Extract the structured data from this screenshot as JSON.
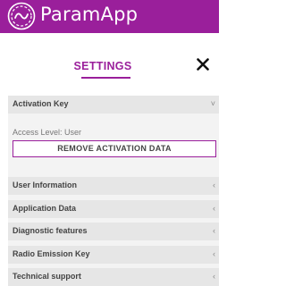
{
  "app_bar": {
    "title": "ParamApp",
    "logo_icon": "wave-gear-logo",
    "background": "#9a1f9b"
  },
  "header": {
    "title": "SETTINGS",
    "close_icon": "close-icon",
    "accent": "#9a1f9b"
  },
  "sections": [
    {
      "label": "Activation Key",
      "expanded": true,
      "chevron": "˅"
    },
    {
      "label": "User Information",
      "expanded": false,
      "chevron": "‹"
    },
    {
      "label": "Application Data",
      "expanded": false,
      "chevron": "‹"
    },
    {
      "label": "Diagnostic features",
      "expanded": false,
      "chevron": "‹"
    },
    {
      "label": "Radio Emission Key",
      "expanded": false,
      "chevron": "‹"
    },
    {
      "label": "Technical support",
      "expanded": false,
      "chevron": "‹"
    }
  ],
  "activation": {
    "access_level": "Access Level: User",
    "remove_button": "REMOVE ACTIVATION DATA"
  }
}
